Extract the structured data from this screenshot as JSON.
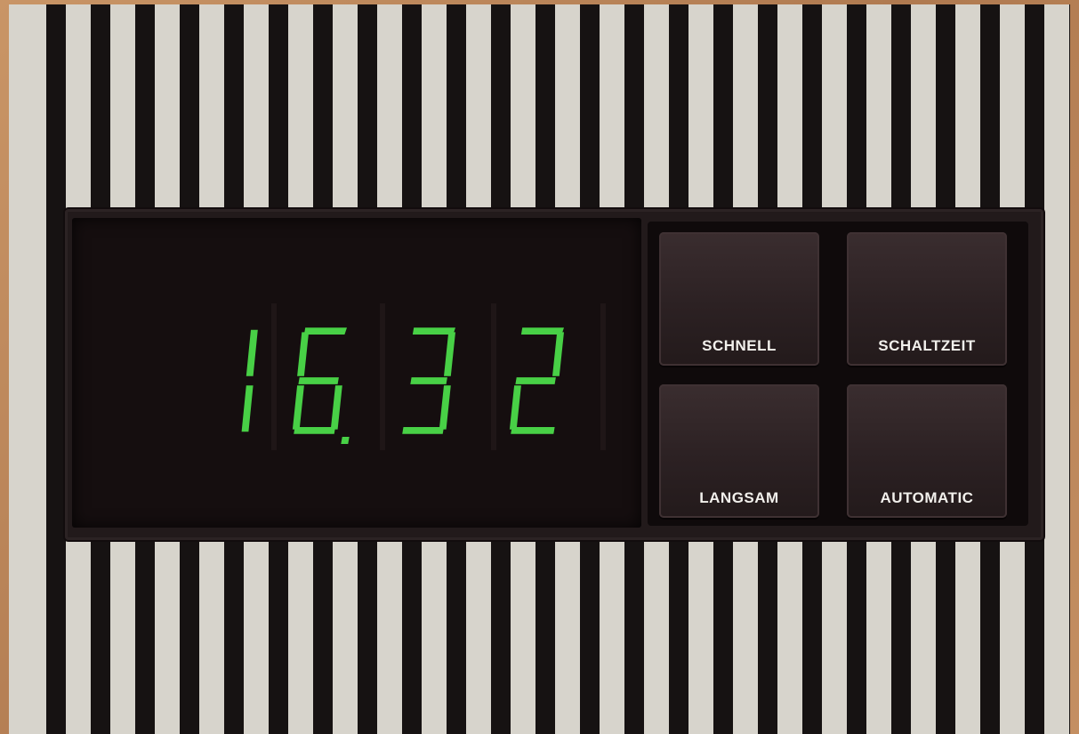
{
  "clock": {
    "time_display": "16.32",
    "digits": [
      "1",
      "6",
      "3",
      "2"
    ],
    "digit_color": "#48d046"
  },
  "buttons": {
    "schnell": "SCHNELL",
    "schaltzeit": "SCHALTZEIT",
    "langsam": "LANGSAM",
    "automatic": "AUTOMATIC"
  },
  "colors": {
    "panel": "#221a1b",
    "stripe": "#161212",
    "background": "#d7d4cc",
    "label": "#f2f0ec"
  }
}
